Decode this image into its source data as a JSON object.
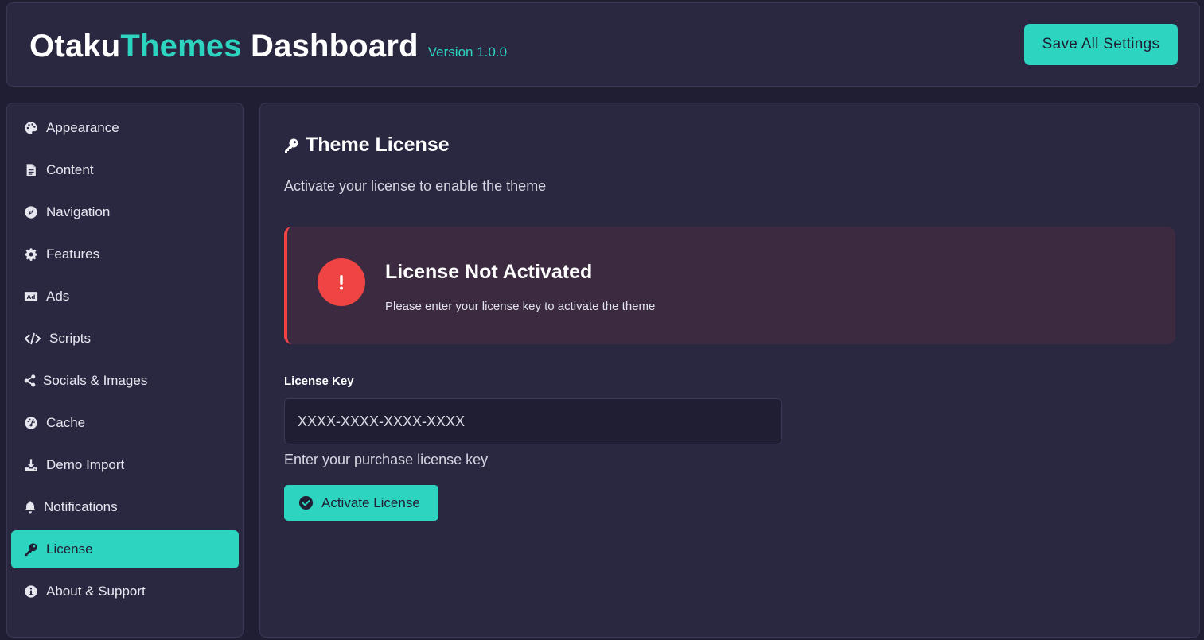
{
  "header": {
    "title_part1": "Otaku",
    "title_accent": "Themes",
    "title_part2": " Dashboard",
    "version": "Version 1.0.0",
    "save_label": "Save All Settings"
  },
  "colors": {
    "accent": "#2dd4bf",
    "danger": "#ef4444",
    "background": "#1f1e33",
    "panel": "#2a2841"
  },
  "sidebar": {
    "items": [
      {
        "label": "Appearance",
        "icon": "palette-icon",
        "active": false
      },
      {
        "label": "Content",
        "icon": "file-icon",
        "active": false
      },
      {
        "label": "Navigation",
        "icon": "compass-icon",
        "active": false
      },
      {
        "label": "Features",
        "icon": "gear-icon",
        "active": false
      },
      {
        "label": "Ads",
        "icon": "ad-icon",
        "active": false
      },
      {
        "label": "Scripts",
        "icon": "code-icon",
        "active": false
      },
      {
        "label": "Socials & Images",
        "icon": "share-icon",
        "active": false
      },
      {
        "label": "Cache",
        "icon": "gauge-icon",
        "active": false
      },
      {
        "label": "Demo Import",
        "icon": "download-icon",
        "active": false
      },
      {
        "label": "Notifications",
        "icon": "bell-icon",
        "active": false
      },
      {
        "label": "License",
        "icon": "key-icon",
        "active": true
      },
      {
        "label": "About & Support",
        "icon": "info-icon",
        "active": false
      }
    ]
  },
  "main": {
    "title": "Theme License",
    "title_icon": "key-icon",
    "subtitle": "Activate your license to enable the theme",
    "alert": {
      "icon": "exclamation-icon",
      "title": "License Not Activated",
      "text": "Please enter your license key to activate the theme"
    },
    "license_field": {
      "label": "License Key",
      "value": "",
      "placeholder": "XXXX-XXXX-XXXX-XXXX",
      "help": "Enter your purchase license key"
    },
    "activate_button": {
      "label": "Activate License",
      "icon": "check-circle-icon"
    }
  }
}
